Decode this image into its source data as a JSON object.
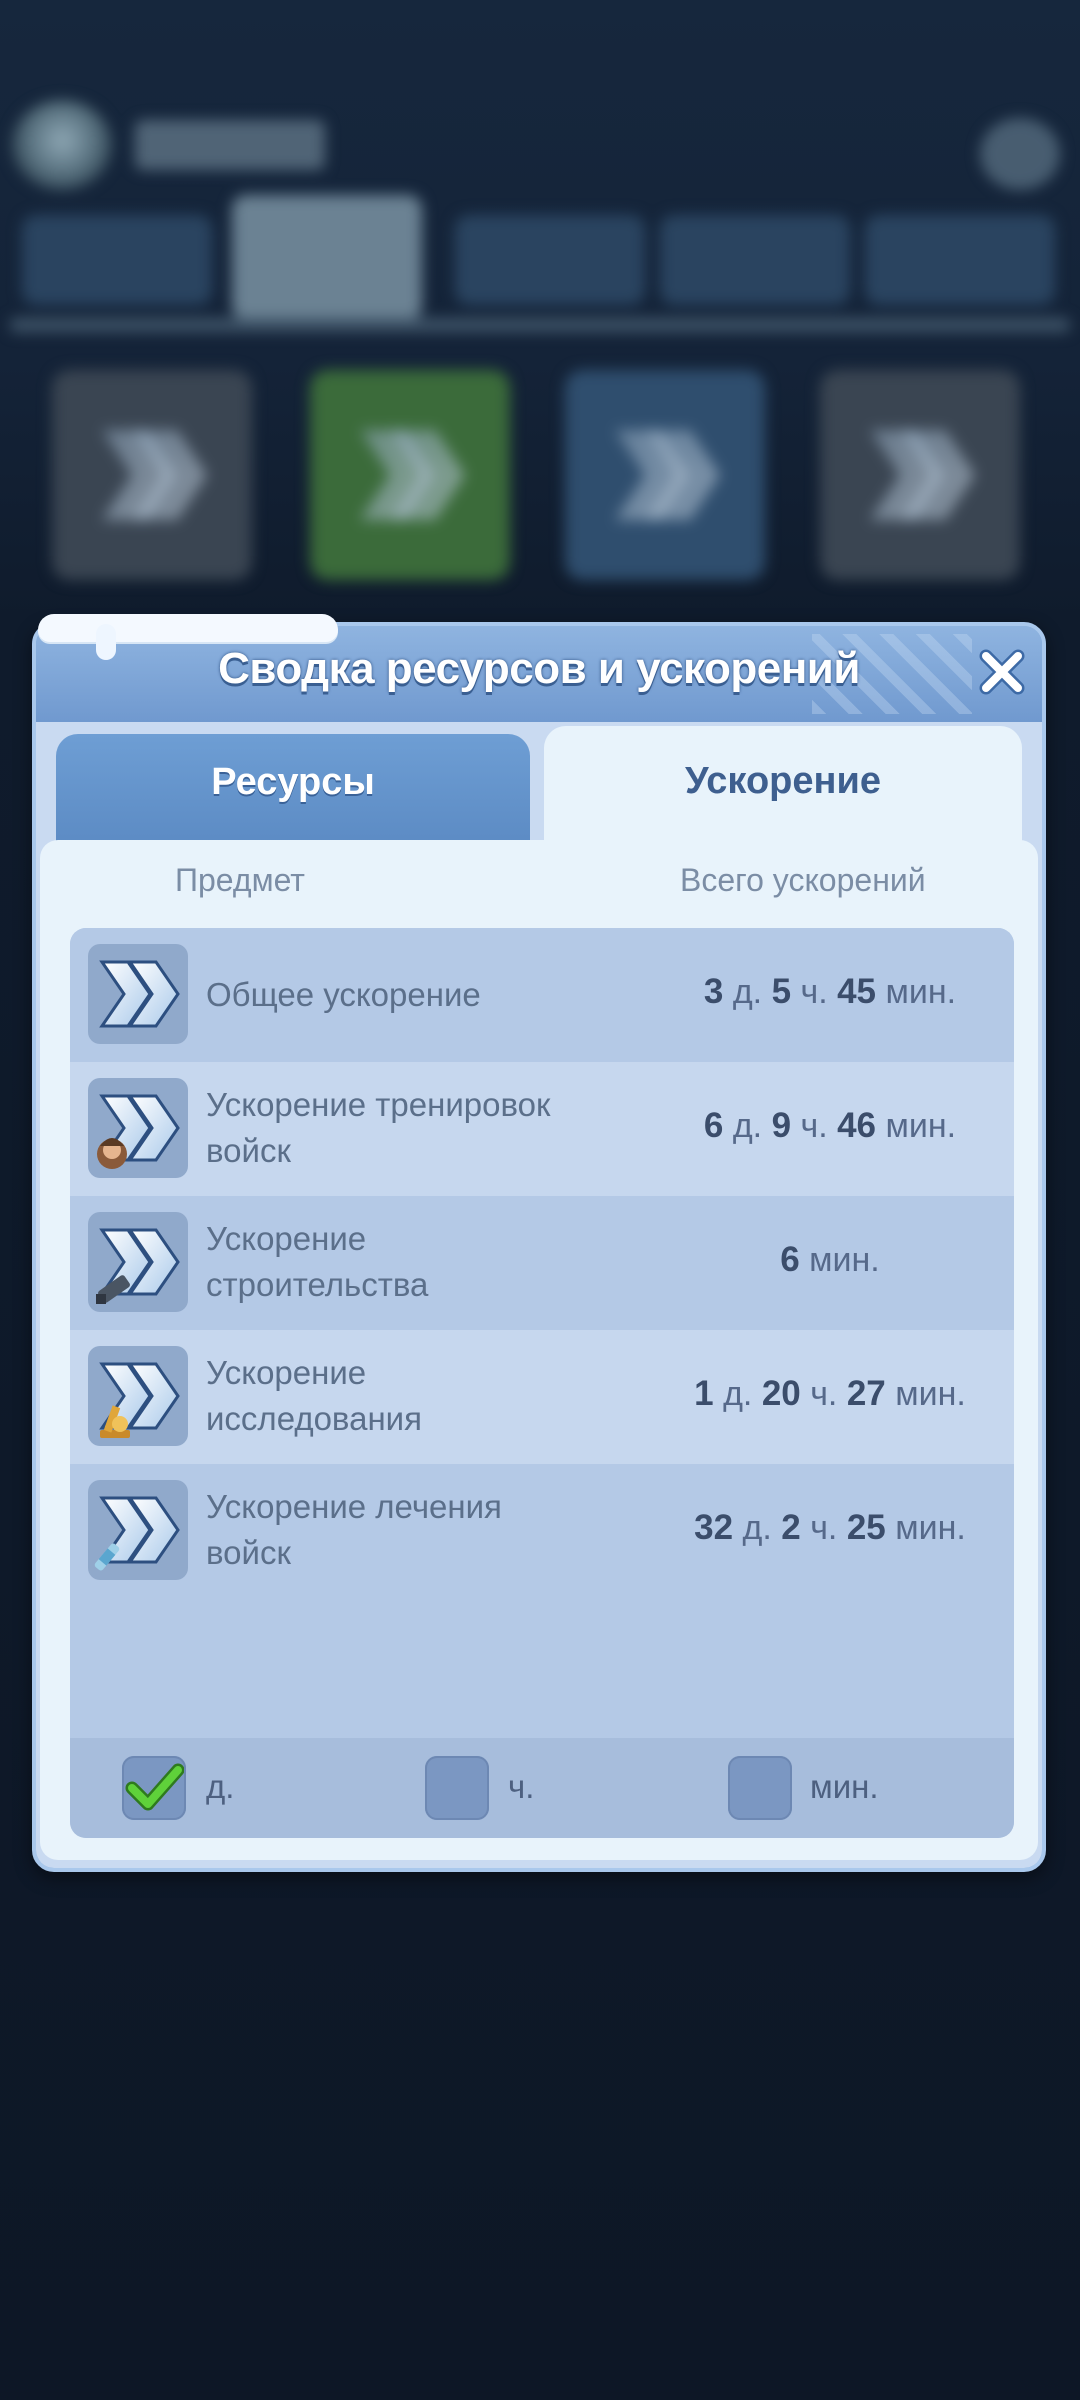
{
  "dialog": {
    "title": "Сводка ресурсов и ускорений",
    "tabs": [
      {
        "label": "Ресурсы",
        "active": false
      },
      {
        "label": "Ускорение",
        "active": true
      }
    ],
    "columns": {
      "item": "Предмет",
      "total": "Всего ускорений"
    },
    "rows": [
      {
        "name": "Общее ускорение",
        "icon": "speedup-icon",
        "value": [
          {
            "n": "3",
            "u": "д."
          },
          {
            "n": "5",
            "u": "ч."
          },
          {
            "n": "45",
            "u": "мин."
          }
        ]
      },
      {
        "name": "Ускорение тренировок войск",
        "icon": "training-speedup-icon",
        "value": [
          {
            "n": "6",
            "u": "д."
          },
          {
            "n": "9",
            "u": "ч."
          },
          {
            "n": "46",
            "u": "мин."
          }
        ]
      },
      {
        "name": "Ускорение строительства",
        "icon": "building-speedup-icon",
        "value": [
          {
            "n": "6",
            "u": "мин."
          }
        ]
      },
      {
        "name": "Ускорение исследования",
        "icon": "research-speedup-icon",
        "value": [
          {
            "n": "1",
            "u": "д."
          },
          {
            "n": "20",
            "u": "ч."
          },
          {
            "n": "27",
            "u": "мин."
          }
        ]
      },
      {
        "name": "Ускорение лечения войск",
        "icon": "healing-speedup-icon",
        "value": [
          {
            "n": "32",
            "u": "д."
          },
          {
            "n": "2",
            "u": "ч."
          },
          {
            "n": "25",
            "u": "мин."
          }
        ]
      }
    ],
    "filters": [
      {
        "label": "д.",
        "checked": true
      },
      {
        "label": "ч.",
        "checked": false
      },
      {
        "label": "мин.",
        "checked": false
      }
    ]
  },
  "colors": {
    "header": "#7099cf",
    "panel": "#e8f3fb",
    "list": "#b4c9e6",
    "check": "#5fd13a"
  }
}
